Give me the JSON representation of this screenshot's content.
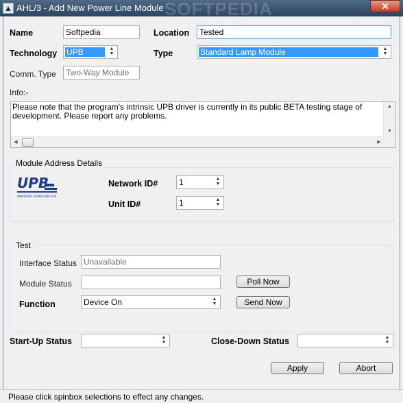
{
  "window": {
    "title": "AHL/3 - Add New Power Line Module",
    "watermark": "SOFTPEDIA",
    "close_glyph": "✕"
  },
  "form": {
    "name_label": "Name",
    "name_value": "Softpedia",
    "location_label": "Location",
    "location_value": "Tested",
    "technology_label": "Technology",
    "technology_value": "UPB",
    "type_label": "Type",
    "type_value": "Standard Lamp Module",
    "comm_type_label": "Comm. Type",
    "comm_type_value": "Two-Way Module",
    "info_label": "Info:-",
    "info_text": "Please note that the program's intrinsic UPB driver is currently in its public BETA testing stage of development. Please report any problems."
  },
  "module_address": {
    "group_title": "Module Address Details",
    "logo_text": "UPB",
    "logo_subtext": "UNIVERSAL POWERLINE BUS",
    "network_id_label": "Network ID#",
    "network_id_value": "1",
    "unit_id_label": "Unit ID#",
    "unit_id_value": "1"
  },
  "test": {
    "group_title": "Test",
    "interface_status_label": "Interface Status",
    "interface_status_value": "Unavailable",
    "module_status_label": "Module Status",
    "module_status_value": "",
    "poll_now_label": "Poll Now",
    "function_label": "Function",
    "function_value": "Device On",
    "send_now_label": "Send Now"
  },
  "startup": {
    "startup_label": "Start-Up Status",
    "startup_value": "",
    "closedown_label": "Close-Down Status",
    "closedown_value": ""
  },
  "actions": {
    "apply_label": "Apply",
    "abort_label": "Abort"
  },
  "statusbar": {
    "text": "Please click spinbox selections to effect any changes."
  },
  "icons": {
    "spin_up": "▲",
    "spin_down": "▼",
    "scroll_up": "▲",
    "scroll_down": "▼",
    "scroll_left": "◀",
    "scroll_right": "▶"
  }
}
